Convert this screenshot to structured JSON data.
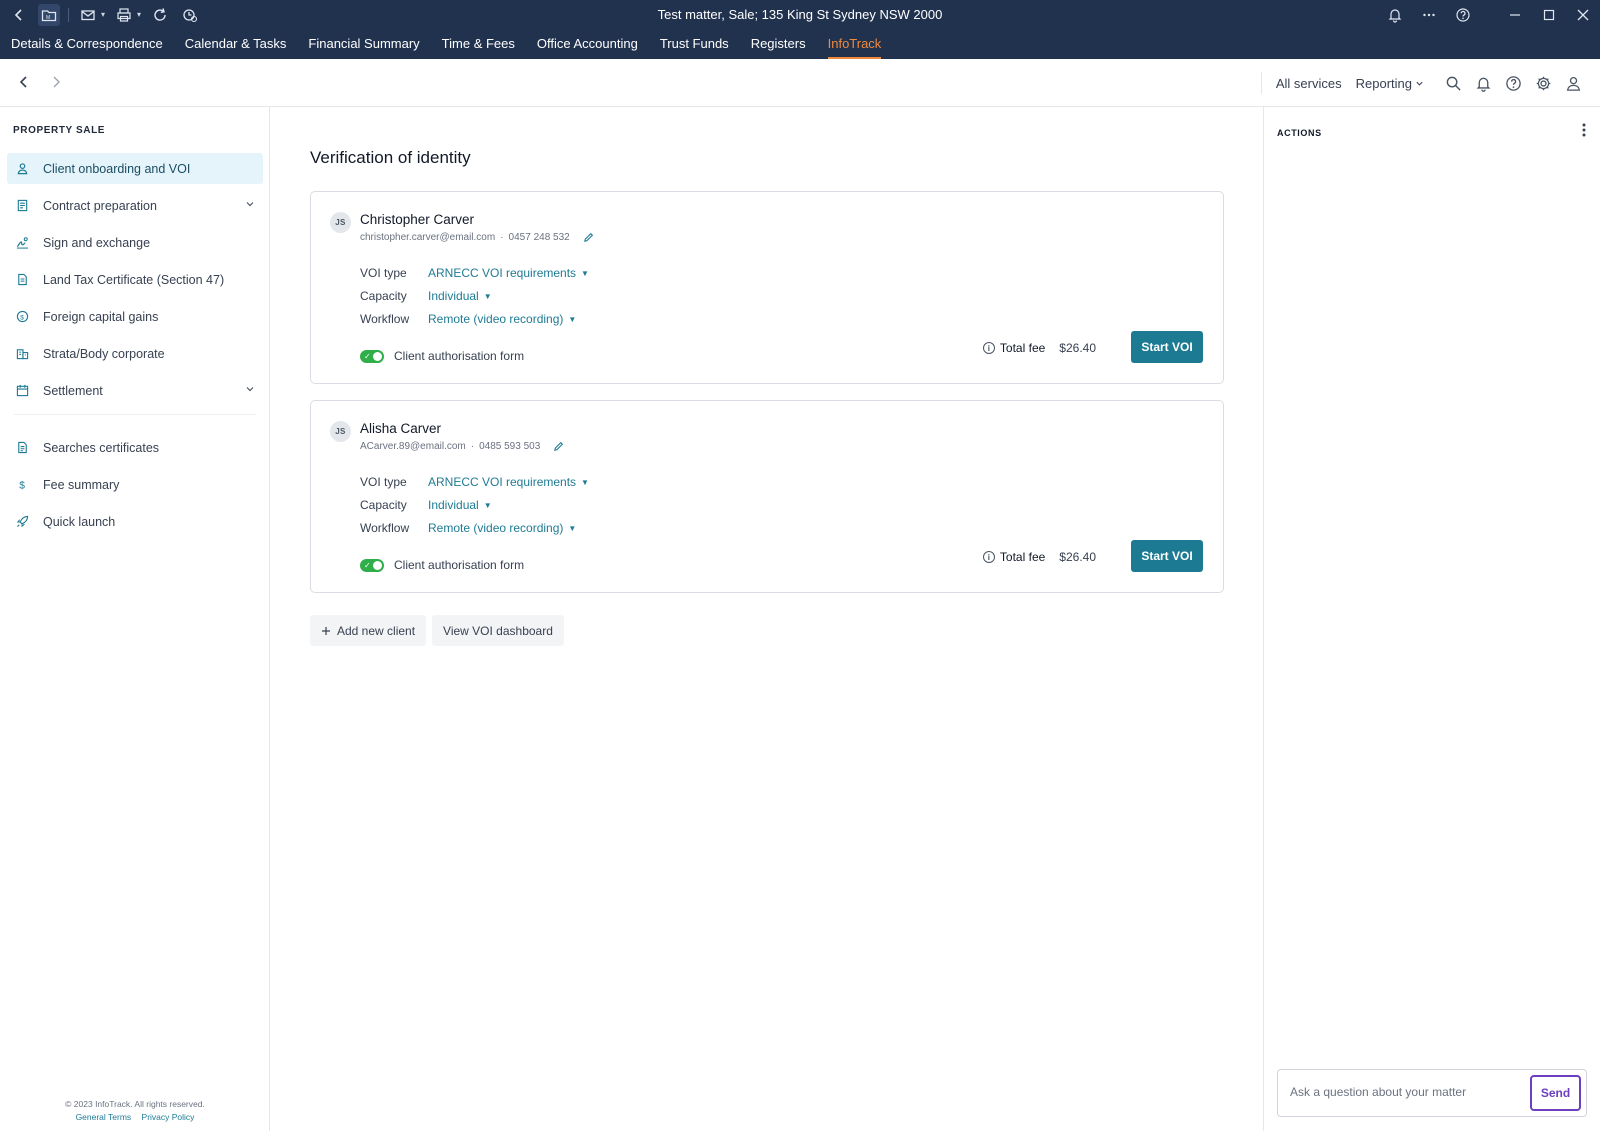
{
  "titlebar": {
    "title": "Test matter,  Sale;  135 King St Sydney NSW 2000",
    "left_icons": [
      "back-icon",
      "matter-folder-icon",
      "mail-icon",
      "print-icon",
      "refresh-icon",
      "clock-icon"
    ],
    "right_icons": [
      "bell-icon",
      "more-icon",
      "help-icon",
      "minimize-icon",
      "maximize-icon",
      "close-icon"
    ]
  },
  "menubar": {
    "items": [
      {
        "label": "Details & Correspondence"
      },
      {
        "label": "Calendar & Tasks"
      },
      {
        "label": "Financial Summary"
      },
      {
        "label": "Time & Fees"
      },
      {
        "label": "Office Accounting"
      },
      {
        "label": "Trust Funds"
      },
      {
        "label": "Registers"
      },
      {
        "label": "InfoTrack"
      }
    ],
    "active": "InfoTrack",
    "active_color": "#f08a3c"
  },
  "navbar": {
    "all_services": "All services",
    "reporting": "Reporting"
  },
  "sidebar": {
    "heading": "PROPERTY SALE",
    "items": [
      {
        "label": "Client onboarding and VOI",
        "icon": "person-icon"
      },
      {
        "label": "Contract preparation",
        "icon": "contract-icon"
      },
      {
        "label": "Sign and exchange",
        "icon": "sign-icon"
      },
      {
        "label": "Land Tax Certificate (Section 47)",
        "icon": "document-icon"
      },
      {
        "label": "Foreign capital gains",
        "icon": "coin-icon"
      },
      {
        "label": "Strata/Body corporate",
        "icon": "building-icon"
      },
      {
        "label": "Settlement",
        "icon": "calendar-icon"
      }
    ],
    "secondary_items": [
      {
        "label": "Searches certificates",
        "icon": "certificate-icon"
      },
      {
        "label": "Fee summary",
        "icon": "dollar-icon"
      },
      {
        "label": "Quick launch",
        "icon": "rocket-icon"
      }
    ],
    "footer": {
      "copyright": "© 2023 InfoTrack. All rights reserved.",
      "terms": "General Terms",
      "privacy": "Privacy Policy"
    }
  },
  "main": {
    "title": "Verification of identity",
    "clients": [
      {
        "initials": "JS",
        "name": "Christopher Carver",
        "email": "christopher.carver@email.com",
        "phone": "0457 248 532",
        "voi_type_label": "VOI type",
        "voi_type": "ARNECC VOI requirements",
        "capacity_label": "Capacity",
        "capacity": "Individual",
        "workflow_label": "Workflow",
        "workflow": "Remote (video recording)",
        "auth_form_label": "Client authorisation form",
        "auth_form_enabled": true,
        "total_fee_label": "Total fee",
        "total_fee": "$26.40",
        "start_label": "Start VOI"
      },
      {
        "initials": "JS",
        "name": "Alisha Carver",
        "email": "ACarver.89@email.com",
        "phone": "0485 593 503",
        "voi_type_label": "VOI type",
        "voi_type": "ARNECC VOI requirements",
        "capacity_label": "Capacity",
        "capacity": "Individual",
        "workflow_label": "Workflow",
        "workflow": "Remote (video recording)",
        "auth_form_label": "Client authorisation form",
        "auth_form_enabled": true,
        "total_fee_label": "Total fee",
        "total_fee": "$26.40",
        "start_label": "Start VOI"
      }
    ],
    "add_client_label": "Add new client",
    "view_dashboard_label": "View VOI dashboard"
  },
  "actions_panel": {
    "heading": "ACTIONS",
    "ask_placeholder": "Ask a question about your matter",
    "send_label": "Send"
  },
  "colors": {
    "titlebar_bg": "#21324f",
    "accent_teal": "#1c7a93",
    "toggle_green": "#2fae4a",
    "send_purple": "#6d3fc0"
  }
}
